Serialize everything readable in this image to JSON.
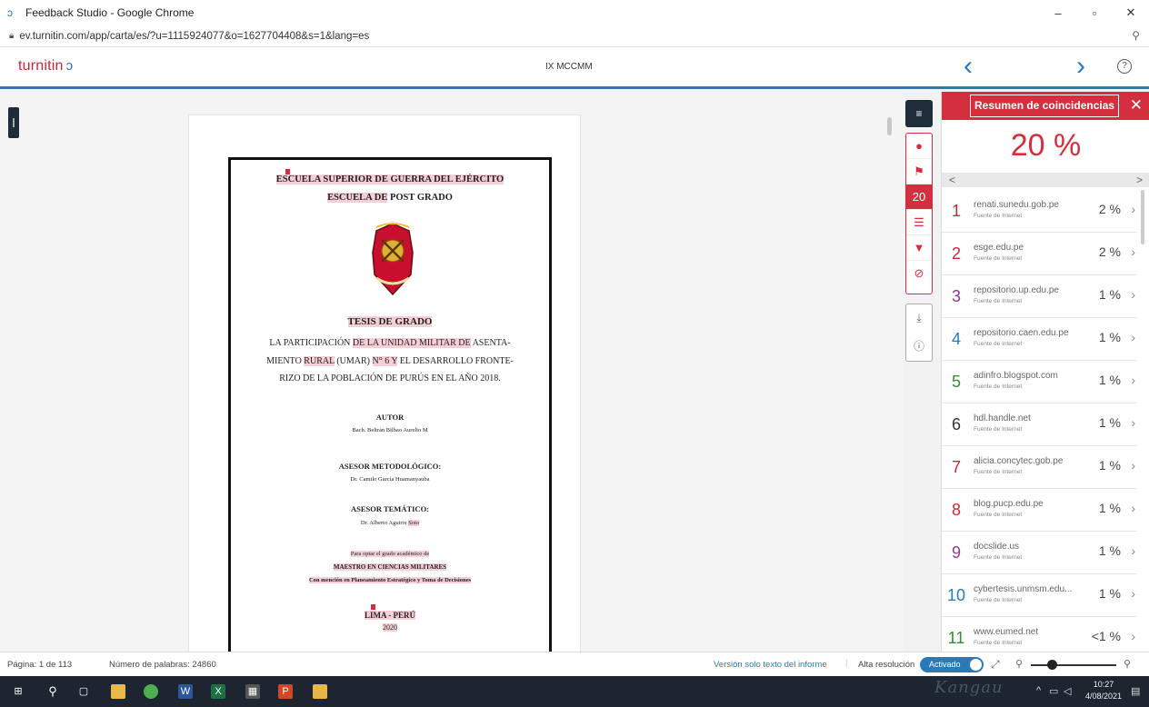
{
  "window": {
    "title": "Feedback Studio - Google Chrome",
    "minimize": "–",
    "maximize": "▫",
    "close": "✕"
  },
  "address": {
    "url": "ev.turnitin.com/app/carta/es/?u=1115924077&o=1627704408&s=1&lang=es"
  },
  "header": {
    "logo": "turnitin",
    "doc_title": "IX MCCMM",
    "prev": "‹",
    "next": "›",
    "help": "?"
  },
  "document": {
    "school": "ESCUELA SUPERIOR DE GUERRA DEL EJÉRCITO",
    "school2_hl": "ESCUELA DE",
    "school2_rest": " POST GRADO",
    "thesis": "TESIS DE GRADO",
    "title_l1_a": "LA PARTICIPACIÓN ",
    "title_l1_hl": "DE LA UNIDAD MILITAR DE",
    "title_l1_b": " ASENTA-",
    "title_l2_a": "MIENTO ",
    "title_l2_hl": "RURAL",
    "title_l2_b": " (UMAR) ",
    "title_l2_hl2": "N° 6 Y",
    "title_l2_c": " EL DESARROLLO FRONTE-",
    "title_l3": "RIZO DE LA POBLACIÓN DE PURÚS EN EL AÑO 2018.",
    "author_label": "AUTOR",
    "author": "Bach. Beltrán Bilbao Aurelio M",
    "method_label": "ASESOR METODOLÓGICO:",
    "method_name": "Dr. Camilo García Huamanyauba",
    "thematic_label": "ASESOR TEMÁTICO:",
    "thematic_name_a": "Dr. Alberto Aguirre ",
    "thematic_name_hl": "Soto",
    "purpose": "Para optar el grado académico de",
    "degree": "MAESTRO EN CIENCIAS MILITARES",
    "mention": "Con mención en Planeamiento Estratégico y Toma de Decisiones",
    "city": "LIMA - PERÚ",
    "year": "2020"
  },
  "tools": {
    "layers": "≡",
    "count": "20",
    "flag": "⚑",
    "list": "☰",
    "filter": "▼",
    "exclude": "⊘",
    "download": "⤓",
    "info": "ⓘ"
  },
  "panel": {
    "title": "Resumen de coincidencias",
    "close": "✕",
    "total": "20 %",
    "pager_prev": "<",
    "pager_next": ">",
    "source_type": "Fuente de Internet",
    "items": [
      {
        "num": "1",
        "source": "renati.sunedu.gob.pe",
        "pct": "2 %",
        "color": "#c4293a"
      },
      {
        "num": "2",
        "source": "esge.edu.pe",
        "pct": "2 %",
        "color": "#c4293a"
      },
      {
        "num": "3",
        "source": "repositorio.up.edu.pe",
        "pct": "1 %",
        "color": "#8e3b8e"
      },
      {
        "num": "4",
        "source": "repositorio.caen.edu.pe",
        "pct": "1 %",
        "color": "#2a7ab8"
      },
      {
        "num": "5",
        "source": "adinfro.blogspot.com",
        "pct": "1 %",
        "color": "#3a8a3a"
      },
      {
        "num": "6",
        "source": "hdl.handle.net",
        "pct": "1 %",
        "color": "#333333"
      },
      {
        "num": "7",
        "source": "alicia.concytec.gob.pe",
        "pct": "1 %",
        "color": "#c4293a"
      },
      {
        "num": "8",
        "source": "blog.pucp.edu.pe",
        "pct": "1 %",
        "color": "#c4293a"
      },
      {
        "num": "9",
        "source": "docslide.us",
        "pct": "1 %",
        "color": "#8e3b8e"
      },
      {
        "num": "10",
        "source": "cybertesis.unmsm.edu...",
        "pct": "1 %",
        "color": "#2a7ab8"
      },
      {
        "num": "11",
        "source": "www.eumed.net",
        "pct": "<1 %",
        "color": "#3a8a3a"
      }
    ]
  },
  "status": {
    "page": "Página: 1 de 113",
    "words": "Número de palabras: 24860",
    "text_only": "Versión solo texto del informe",
    "hires_label": "Alta resolución",
    "hires_state": "Activado"
  },
  "taskbar": {
    "time": "10:27",
    "date": "4/08/2021",
    "watermark": "Kangau"
  }
}
